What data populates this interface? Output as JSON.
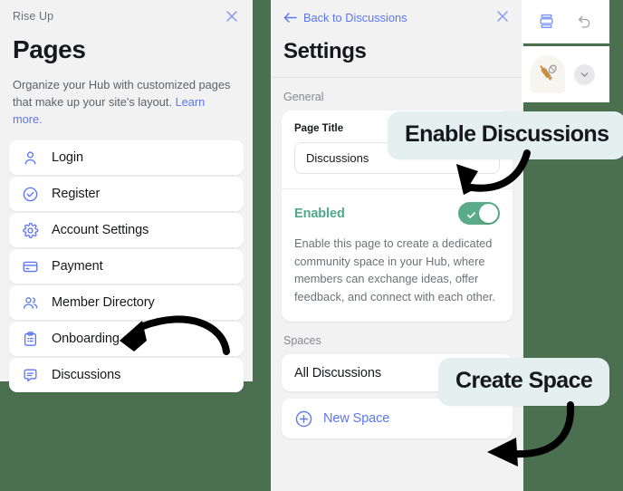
{
  "background_color": "#4a7050",
  "accent_blue": "#5b76f7",
  "accent_green": "#5aab8a",
  "callout_bg": "#e4eff0",
  "pages_panel": {
    "brand": "Rise Up",
    "title": "Pages",
    "description_text": "Organize your Hub with customized pages that make up your site's layout. ",
    "description_link": "Learn more.",
    "close_icon": "close-icon",
    "items": [
      {
        "label": "Login",
        "icon": "user-icon"
      },
      {
        "label": "Register",
        "icon": "check-circle-icon"
      },
      {
        "label": "Account Settings",
        "icon": "gear-icon"
      },
      {
        "label": "Payment",
        "icon": "credit-card-icon"
      },
      {
        "label": "Member Directory",
        "icon": "users-icon"
      },
      {
        "label": "Onboarding",
        "icon": "clipboard-list-icon"
      },
      {
        "label": "Discussions",
        "icon": "chat-bubble-icon"
      }
    ]
  },
  "settings_panel": {
    "back_label": "Back to Discussions",
    "back_icon": "arrow-left-icon",
    "close_icon": "close-icon",
    "title": "Settings",
    "general_label": "General",
    "page_title_field": {
      "label": "Page Title",
      "value": "Discussions"
    },
    "enabled": {
      "label": "Enabled",
      "toggle_state": "on",
      "toggle_icon": "check-icon",
      "description": "Enable this page to create a dedicated community space in your Hub, where members can exchange ideas, offer feedback, and connect with each other."
    },
    "spaces_label": "Spaces",
    "spaces": [
      {
        "label": "All Discussions"
      }
    ],
    "new_space": {
      "label": "New Space",
      "icon": "plus-circle-icon"
    }
  },
  "right_panel": {
    "toolbar": [
      {
        "name": "sections-icon"
      },
      {
        "name": "undo-icon"
      }
    ],
    "site_logo_icon": "rolling-pin-whisk-logo",
    "expand_icon": "chevron-down-icon"
  },
  "callouts": [
    {
      "id": "enable",
      "label": "Enable Discussions"
    },
    {
      "id": "create",
      "label": "Create Space"
    }
  ],
  "annotation_arrows": [
    {
      "name": "arrow-to-discussions"
    },
    {
      "name": "arrow-to-enable-toggle"
    },
    {
      "name": "arrow-to-new-space"
    }
  ]
}
